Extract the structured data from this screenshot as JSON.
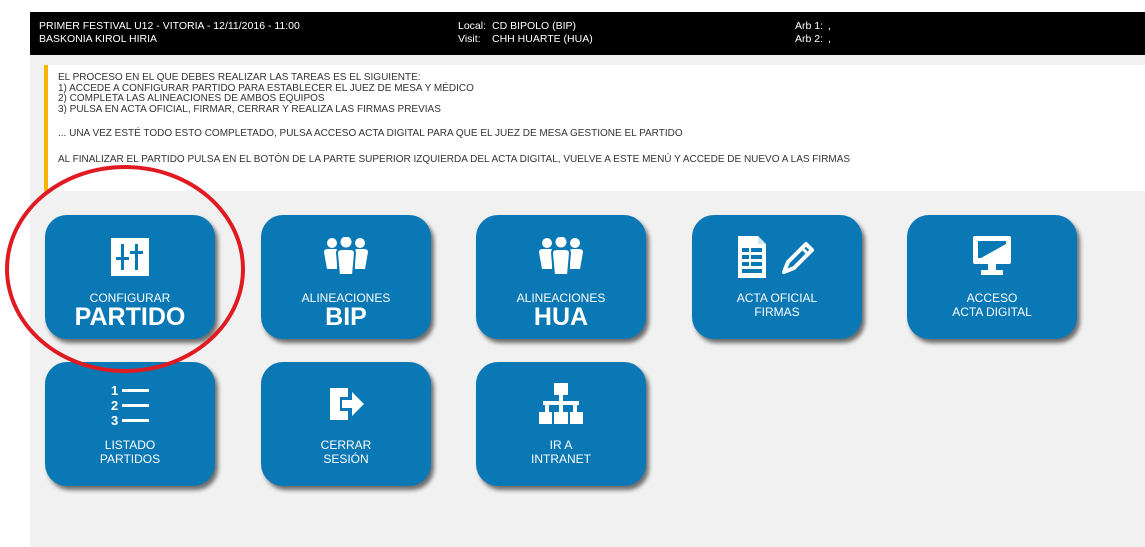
{
  "header": {
    "match_title": "PRIMER FESTIVAL U12 - VITORIA - 12/11/2016 - 11:00",
    "club": "BASKONIA KIROL HIRIA",
    "local_label": "Local:",
    "local_team": "CD BIPOLO (BIP)",
    "visit_label": "Visit:",
    "visit_team": "CHH HUARTE (HUA)",
    "arb1_label": "Arb 1:",
    "arb1_value": ",",
    "arb2_label": "Arb 2:",
    "arb2_value": ","
  },
  "notice": {
    "lines": [
      "EL PROCESO EN EL QUE DEBES REALIZAR LAS TAREAS ES EL SIGUIENTE:",
      "1) ACCEDE A CONFIGURAR PARTIDO PARA ESTABLECER EL JUEZ DE MESA Y MÉDICO",
      "2) COMPLETA LAS ALINEACIONES DE AMBOS EQUIPOS",
      "3) PULSA EN ACTA OFICIAL, FIRMAR, CERRAR Y REALIZA LAS FIRMAS PREVIAS"
    ],
    "line_digital": "... UNA VEZ ESTÉ TODO ESTO COMPLETADO, PULSA ACCESO ACTA DIGITAL PARA QUE EL JUEZ DE MESA GESTIONE EL PARTIDO",
    "line_final": "AL FINALIZAR EL PARTIDO PULSA EN EL BOTÓN DE LA PARTE SUPERIOR IZQUIERDA DEL ACTA DIGITAL, VUELVE A ESTE MENÚ Y ACCEDE DE NUEVO A LAS FIRMAS",
    "accent_color": "#f7b500"
  },
  "tiles": {
    "configurar": {
      "line1": "CONFIGURAR",
      "big": "PARTIDO",
      "icon": "sliders-icon"
    },
    "alineaciones_bip": {
      "line1": "ALINEACIONES",
      "big": "BIP",
      "icon": "team-icon"
    },
    "alineaciones_hua": {
      "line1": "ALINEACIONES",
      "big": "HUA",
      "icon": "team-icon"
    },
    "acta_oficial": {
      "line1": "ACTA OFICIAL",
      "line2": "FIRMAS",
      "icon": "document-pencil-icon"
    },
    "acceso_acta": {
      "line1": "ACCESO",
      "line2": "ACTA DIGITAL",
      "icon": "monitor-icon"
    },
    "listado": {
      "line1": "LISTADO",
      "line2": "PARTIDOS",
      "icon": "numbered-list-icon"
    },
    "cerrar": {
      "line1": "CERRAR",
      "line2": "SESIÓN",
      "icon": "logout-icon"
    },
    "intranet": {
      "line1": "IR A",
      "line2": "INTRANET",
      "icon": "sitemap-icon"
    }
  },
  "colors": {
    "tile_bg": "#0a78b4",
    "highlight": "#e11a22",
    "header_bg": "#000000",
    "content_bg": "#f1f1f1"
  }
}
